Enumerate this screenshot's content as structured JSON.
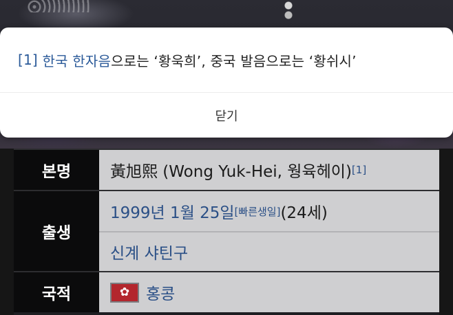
{
  "popup": {
    "ref_marker": "[1]",
    "link_text": "한국 한자음",
    "text_after_link": "으로는 ‘황욱희’, 중국 발음으로는 ‘황쉬시’",
    "close_label": "닫기"
  },
  "infobox": {
    "name_row": {
      "header": "본명",
      "value": "黃旭熙 (Wong Yuk-Hei, 웡육헤이)",
      "ref": "[1]"
    },
    "birth_row": {
      "header": "출생",
      "date": "1999년 1월 25일",
      "date_note": "[빠른생일]",
      "age": " (24세)",
      "place": "신계 샤틴구"
    },
    "nationality_row": {
      "header": "국적",
      "flag": "hong-kong-flag-icon",
      "value": "홍콩"
    }
  },
  "colors": {
    "link": "#2a4f86",
    "header_bg": "#0b0b0c",
    "cell_bg": "#cfcfd1"
  }
}
